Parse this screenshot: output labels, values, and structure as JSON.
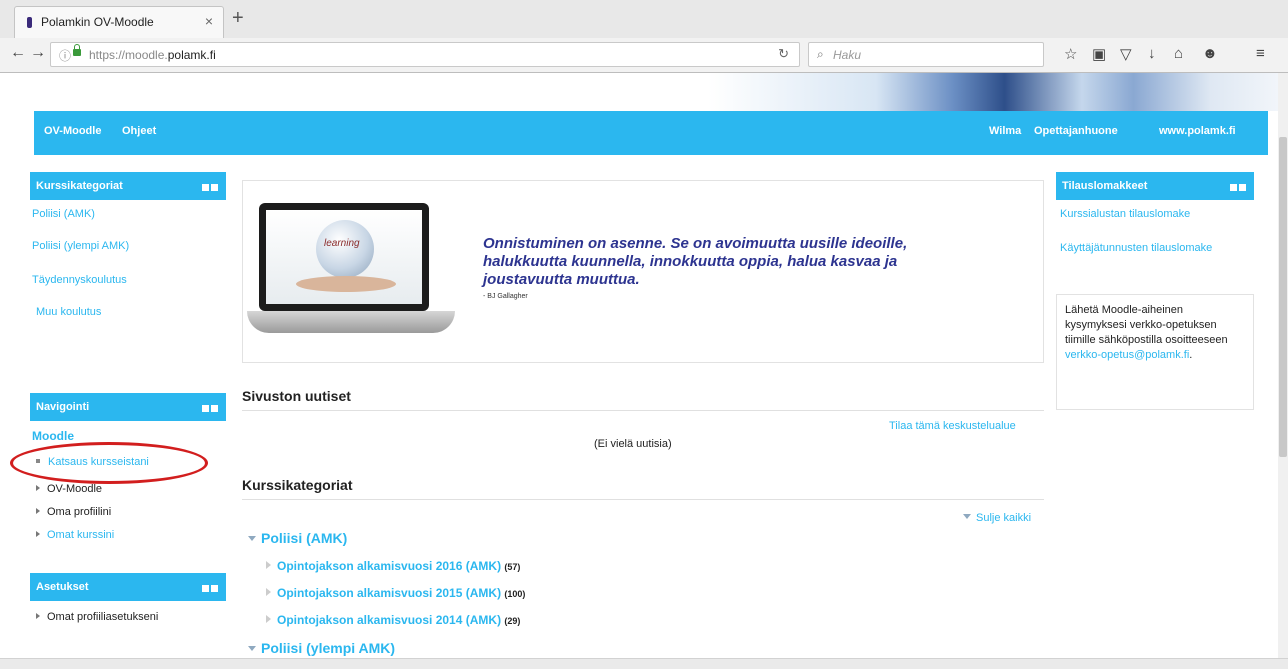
{
  "browser": {
    "tab_title": "Polamkin OV-Moodle",
    "tab_close": "×",
    "new_tab": "+",
    "url_prefix": "https://moodle.",
    "url_domain": "polamk.fi",
    "search_placeholder": "Haku",
    "icons": [
      "back-icon",
      "forward-icon",
      "info-icon",
      "lock-icon",
      "reload-icon",
      "search-icon",
      "bookmark-star-icon",
      "library-icon",
      "pocket-icon",
      "download-icon",
      "home-icon",
      "smiley-icon",
      "menu-icon"
    ]
  },
  "topnav": {
    "left": [
      "OV-Moodle",
      "Ohjeet"
    ],
    "right": [
      "Wilma",
      "Opettajanhuone",
      "www.polamk.fi"
    ]
  },
  "left_blocks": {
    "categories": {
      "title": "Kurssikategoriat",
      "items": [
        "Poliisi (AMK)",
        "Poliisi (ylempi AMK)",
        "Täydennyskoulutus",
        "Muu koulutus"
      ]
    },
    "navigation": {
      "title": "Navigointi",
      "root": "Moodle",
      "items": [
        "Katsaus kursseistani",
        "OV-Moodle",
        "Oma profiilini",
        "Omat kurssini"
      ]
    },
    "settings": {
      "title": "Asetukset",
      "items": [
        "Omat profiiliasetukseni"
      ]
    }
  },
  "quote": {
    "text": "Onnistuminen on asenne. Se on avoimuutta uusille ideoille, halukkuutta kuunnella, innokkuutta oppia, halua kasvaa ja joustavuutta muuttua.",
    "author": "- BJ Gallagher",
    "image_word": "learning"
  },
  "news": {
    "heading": "Sivuston uutiset",
    "subscribe": "Tilaa tämä keskustelualue",
    "empty": "(Ei vielä uutisia)"
  },
  "course_categories": {
    "heading": "Kurssikategoriat",
    "collapse_all": "Sulje kaikki",
    "categories": [
      {
        "name": "Poliisi (AMK)",
        "subs": [
          {
            "name": "Opintojakson alkamisvuosi 2016 (AMK)",
            "count": "(57)"
          },
          {
            "name": "Opintojakson alkamisvuosi 2015 (AMK)",
            "count": "(100)"
          },
          {
            "name": "Opintojakson alkamisvuosi 2014 (AMK)",
            "count": "(29)"
          }
        ]
      },
      {
        "name": "Poliisi (ylempi AMK)",
        "subs": []
      }
    ]
  },
  "right_blocks": {
    "order_forms": {
      "title": "Tilauslomakkeet",
      "items": [
        "Kurssialustan tilauslomake",
        "Käyttäjätunnusten tilauslomake"
      ]
    },
    "contact": {
      "text": "Lähetä Moodle-aiheinen kysymyksesi verkko-opetuksen tiimille sähköpostilla osoitteeseen",
      "email": "verkko-opetus@polamk.fi",
      "suffix": "."
    }
  },
  "colors": {
    "accent": "#2bb7ef",
    "quote": "#2d3490",
    "highlight": "#d21e1e"
  }
}
